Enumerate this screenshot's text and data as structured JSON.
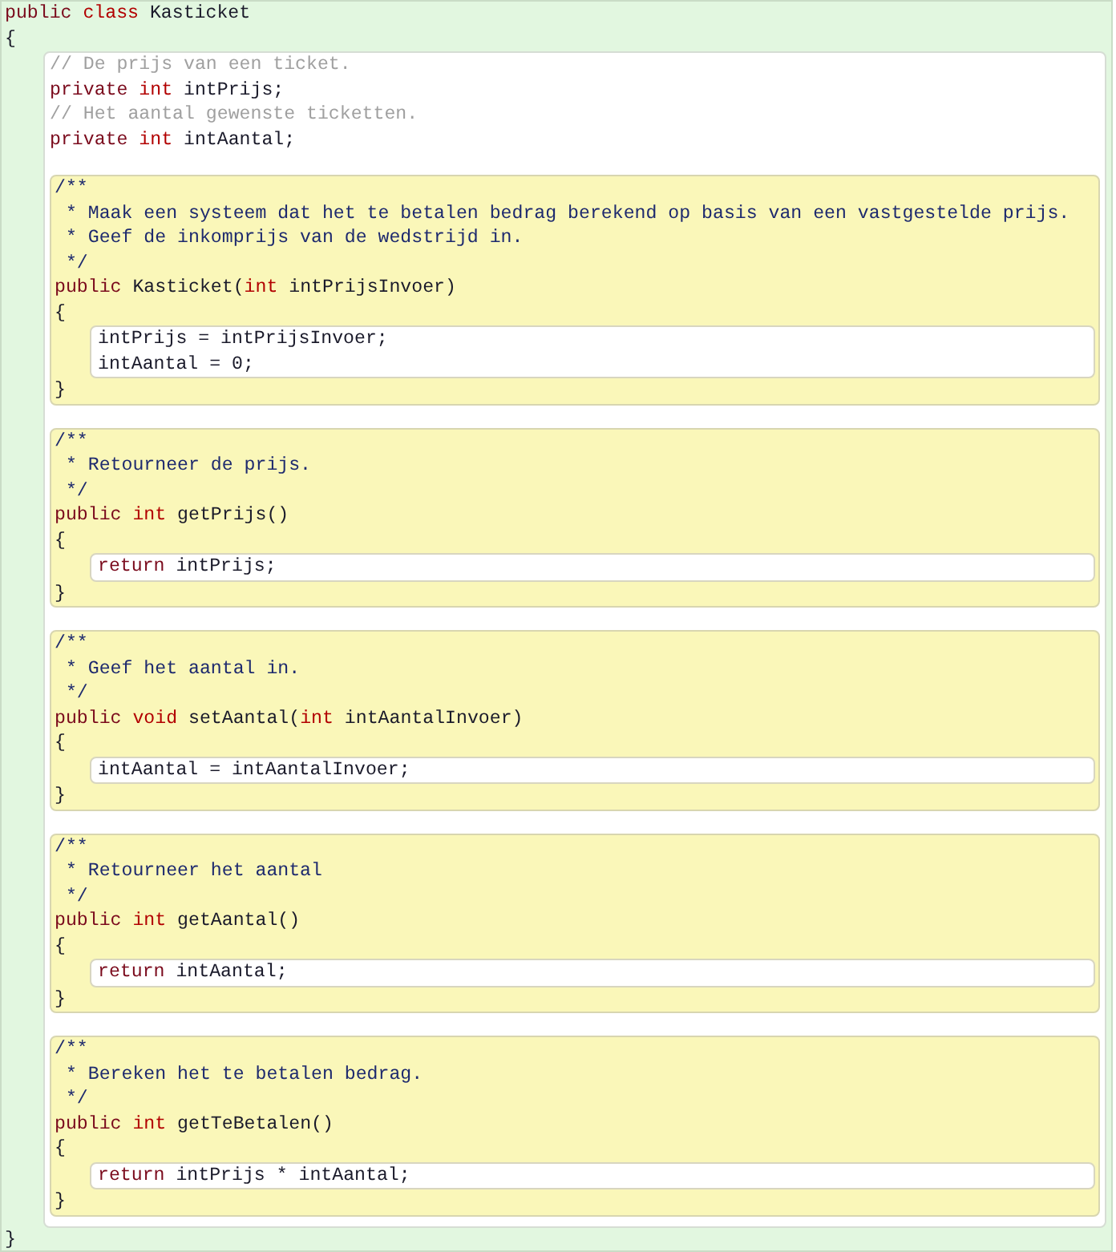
{
  "class": {
    "header": [
      {
        "kind": "keyword",
        "text": "public "
      },
      {
        "kind": "type",
        "text": "class"
      },
      {
        "kind": "plain",
        "text": " Kasticket"
      }
    ],
    "open": "{",
    "fields": [
      [
        {
          "kind": "comment",
          "text": "// De prijs van een ticket."
        }
      ],
      [
        {
          "kind": "keyword",
          "text": "private "
        },
        {
          "kind": "type",
          "text": "int"
        },
        {
          "kind": "plain",
          "text": " intPrijs;"
        }
      ],
      [
        {
          "kind": "comment",
          "text": "// Het aantal gewenste ticketten."
        }
      ],
      [
        {
          "kind": "keyword",
          "text": "private "
        },
        {
          "kind": "type",
          "text": "int"
        },
        {
          "kind": "plain",
          "text": " intAantal;"
        }
      ]
    ],
    "methods": [
      {
        "doc": [
          "/**",
          " * Maak een systeem dat het te betalen bedrag berekend op basis van een vastgestelde prijs.",
          " * Geef de inkomprijs van de wedstrijd in.",
          " */"
        ],
        "signature": [
          {
            "kind": "keyword",
            "text": "public"
          },
          {
            "kind": "plain",
            "text": " Kasticket("
          },
          {
            "kind": "type",
            "text": "int"
          },
          {
            "kind": "plain",
            "text": " intPrijsInvoer)"
          }
        ],
        "open": "{",
        "body": [
          [
            {
              "kind": "plain",
              "text": "intPrijs = intPrijsInvoer;"
            }
          ],
          [
            {
              "kind": "plain",
              "text": "intAantal = 0;"
            }
          ]
        ],
        "close": "}"
      },
      {
        "doc": [
          "/**",
          " * Retourneer de prijs.",
          " */"
        ],
        "signature": [
          {
            "kind": "keyword",
            "text": "public "
          },
          {
            "kind": "type",
            "text": "int"
          },
          {
            "kind": "plain",
            "text": " getPrijs()"
          }
        ],
        "open": "{",
        "body": [
          [
            {
              "kind": "keyword",
              "text": "return"
            },
            {
              "kind": "plain",
              "text": " intPrijs;"
            }
          ]
        ],
        "close": "}"
      },
      {
        "doc": [
          "/**",
          " * Geef het aantal in.",
          " */"
        ],
        "signature": [
          {
            "kind": "keyword",
            "text": "public "
          },
          {
            "kind": "type",
            "text": "void"
          },
          {
            "kind": "plain",
            "text": " setAantal("
          },
          {
            "kind": "type",
            "text": "int"
          },
          {
            "kind": "plain",
            "text": " intAantalInvoer)"
          }
        ],
        "open": "{",
        "body": [
          [
            {
              "kind": "plain",
              "text": "intAantal = intAantalInvoer;"
            }
          ]
        ],
        "close": "}"
      },
      {
        "doc": [
          "/**",
          " * Retourneer het aantal",
          " */"
        ],
        "signature": [
          {
            "kind": "keyword",
            "text": "public "
          },
          {
            "kind": "type",
            "text": "int"
          },
          {
            "kind": "plain",
            "text": " getAantal()"
          }
        ],
        "open": "{",
        "body": [
          [
            {
              "kind": "keyword",
              "text": "return"
            },
            {
              "kind": "plain",
              "text": " intAantal;"
            }
          ]
        ],
        "close": "}"
      },
      {
        "doc": [
          "/**",
          " * Bereken het te betalen bedrag.",
          " */"
        ],
        "signature": [
          {
            "kind": "keyword",
            "text": "public "
          },
          {
            "kind": "type",
            "text": "int"
          },
          {
            "kind": "plain",
            "text": " getTeBetalen()"
          }
        ],
        "open": "{",
        "body": [
          [
            {
              "kind": "keyword",
              "text": "return"
            },
            {
              "kind": "plain",
              "text": " intPrijs * intAantal;"
            }
          ]
        ],
        "close": "}"
      }
    ],
    "close": "}"
  }
}
